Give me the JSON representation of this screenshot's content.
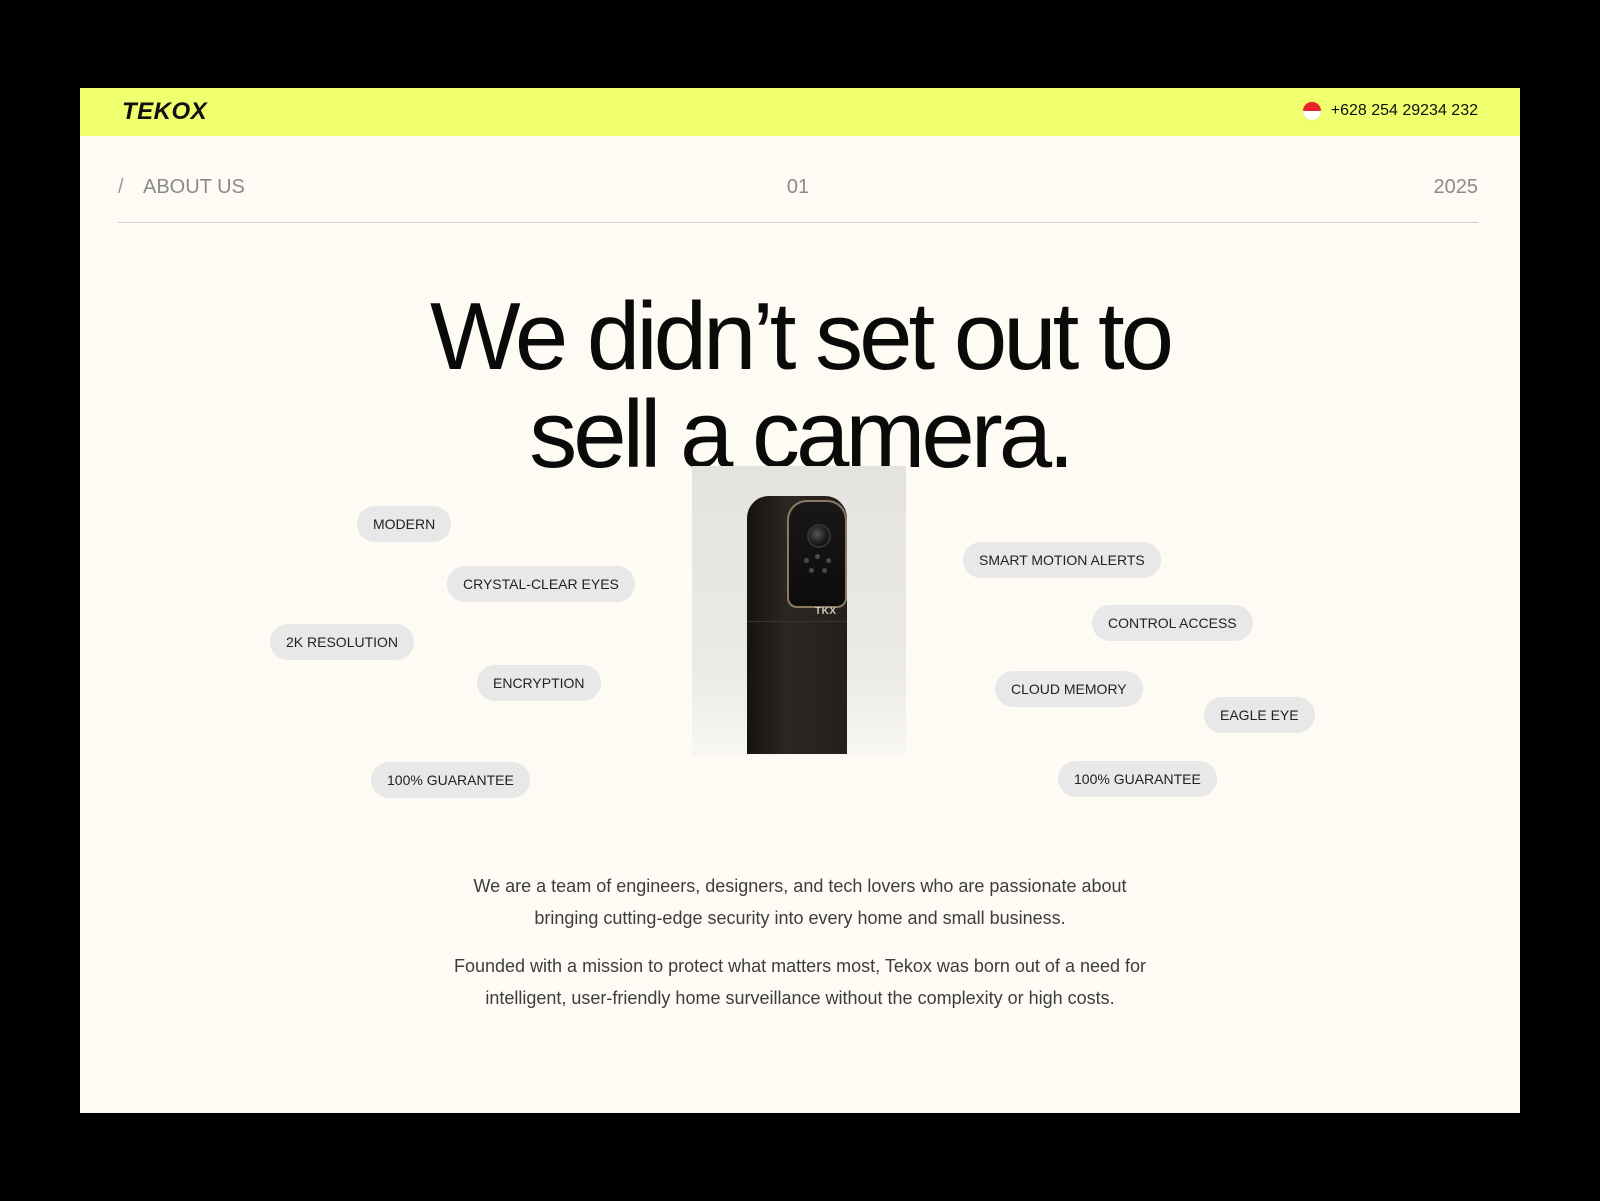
{
  "topbar": {
    "logo": "TEKOX",
    "phone": "+628 254 29234 232",
    "flag_icon": "indonesia-flag-icon"
  },
  "subnav": {
    "slash": "/",
    "section": "ABOUT US",
    "number": "01",
    "year": "2025"
  },
  "hero": {
    "line1": "We didn’t set out to",
    "line2": "sell a camera."
  },
  "product": {
    "label": "TKX"
  },
  "tags": {
    "modern": "MODERN",
    "crystal": "CRYSTAL-CLEAR EYES",
    "resolution": "2K RESOLUTION",
    "encryption": "ENCRYPTION",
    "guarantee_left": "100% GUARANTEE",
    "smart_motion": "SMART MOTION ALERTS",
    "control_access": "CONTROL ACCESS",
    "cloud_memory": "CLOUD MEMORY",
    "eagle_eye": "EAGLE EYE",
    "guarantee_right": "100% GUARANTEE"
  },
  "about": {
    "p1_line1": "We are a team of engineers, designers, and tech lovers who are passionate about",
    "p1_line2": "bringing cutting-edge security into every home and small business.",
    "p2_line1": "Founded with a mission to protect what matters most, Tekox was born out of a need for",
    "p2_line2": "intelligent, user-friendly home surveillance without the complexity or high costs."
  },
  "colors": {
    "accent": "#f0ff6e",
    "page_bg": "#fdfbf3",
    "frame": "#000000"
  }
}
